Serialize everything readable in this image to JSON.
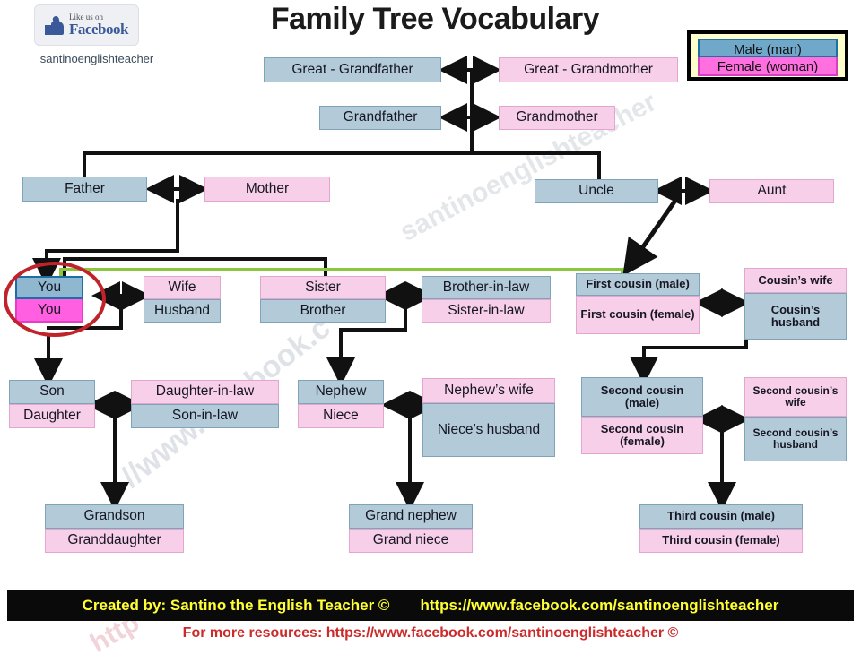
{
  "header": {
    "title": "Family Tree Vocabulary",
    "badge": {
      "small_text": "Like us on",
      "big_text": "Facebook",
      "icon": "thumbs-up-icon"
    },
    "handle": "santinoenglishteacher"
  },
  "legend": {
    "male_label": "Male (man)",
    "female_label": "Female (woman)",
    "male_color": "#6fa8c9",
    "female_color": "#ff6fe0",
    "background_color": "#ffffcc"
  },
  "colors": {
    "male_box": "#b3cbd9",
    "female_box": "#f7cfe8",
    "connector": "#111111",
    "cousin_link": "#8cc63f",
    "highlight_circle": "#c0232a",
    "footer_bg": "#0a0a0a",
    "footer_text": "#ffff33",
    "footnote_text": "#cc2b2b"
  },
  "nodes": {
    "great_grandfather": "Great - Grandfather",
    "great_grandmother": "Great - Grandmother",
    "grandfather": "Grandfather",
    "grandmother": "Grandmother",
    "father": "Father",
    "mother": "Mother",
    "uncle": "Uncle",
    "aunt": "Aunt",
    "you_male": "You",
    "you_female": "You",
    "wife": "Wife",
    "husband": "Husband",
    "sister": "Sister",
    "brother": "Brother",
    "brother_in_law": "Brother-in-law",
    "sister_in_law": "Sister-in-law",
    "first_cousin_male": "First cousin (male)",
    "first_cousin_female": "First cousin (female)",
    "cousins_wife": "Cousin’s wife",
    "cousins_husband": "Cousin’s husband",
    "son": "Son",
    "daughter": "Daughter",
    "daughter_in_law": "Daughter-in-law",
    "son_in_law": "Son-in-law",
    "nephew": "Nephew",
    "niece": "Niece",
    "nephews_wife": "Nephew’s wife",
    "nieces_husband": "Niece’s husband",
    "second_cousin_male": "Second cousin (male)",
    "second_cousin_female": "Second cousin (female)",
    "second_cousins_wife": "Second cousin’s wife",
    "second_cousins_husband": "Second cousin’s husband",
    "grandson": "Grandson",
    "granddaughter": "Granddaughter",
    "grand_nephew": "Grand nephew",
    "grand_niece": "Grand niece",
    "third_cousin_male": "Third cousin (male)",
    "third_cousin_female": "Third cousin (female)"
  },
  "footer": {
    "created_by": "Created by: Santino the English Teacher ©",
    "url": "https://www.facebook.com/santinoenglishteacher",
    "note": "For more resources: https://www.facebook.com/santinoenglishteacher ©"
  },
  "watermark": {
    "line1": "//www.facebook.c",
    "line2": "santinoenglishteacher",
    "line3": "http"
  }
}
